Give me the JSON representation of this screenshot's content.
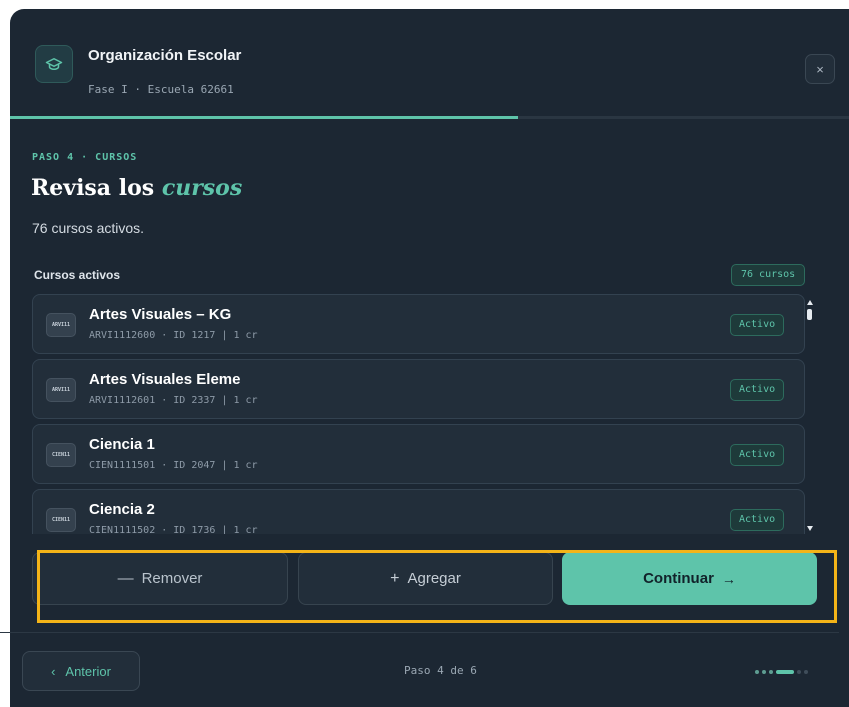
{
  "header": {
    "title": "Organización Escolar",
    "subtitle": "Fase I · Escuela 62661",
    "close_label": "×",
    "progress": 0.605
  },
  "step": {
    "label": "PASO 4 · CURSOS",
    "heading_prefix": "Revisa los",
    "heading_emphasis": "cursos",
    "description": "76 cursos activos."
  },
  "list": {
    "title": "Cursos activos",
    "count_badge": "76 cursos",
    "items": [
      {
        "icon_text": "ARVI11",
        "name": "Artes Visuales – KG",
        "meta": "ARVI1112600 · ID 1217 | 1 cr",
        "status": "Activo"
      },
      {
        "icon_text": "ARVI11",
        "name": "Artes Visuales Eleme",
        "meta": "ARVI1112601 · ID 2337 | 1 cr",
        "status": "Activo"
      },
      {
        "icon_text": "CIEN11",
        "name": "Ciencia 1",
        "meta": "CIEN1111501 · ID 2047 | 1 cr",
        "status": "Activo"
      },
      {
        "icon_text": "CIEN11",
        "name": "Ciencia 2",
        "meta": "CIEN1111502 · ID 1736 | 1 cr",
        "status": "Activo"
      }
    ]
  },
  "actions": {
    "remove_icon": "—",
    "remove_label": "Remover",
    "add_icon": "+",
    "add_label": "Agregar",
    "continue_label": "Continuar",
    "continue_icon": "→"
  },
  "footer": {
    "prev_icon": "‹",
    "prev_label": "Anterior",
    "step_count": "Paso 4 de 6",
    "total_steps": 6,
    "current_step": 4
  },
  "colors": {
    "accent": "#5ec4aa",
    "background": "#1c2733",
    "card": "#222e3a",
    "highlight": "#f4b418"
  }
}
